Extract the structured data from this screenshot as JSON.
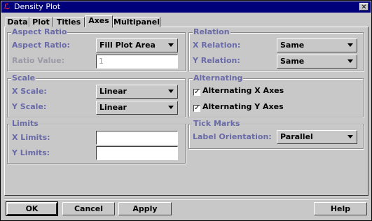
{
  "window": {
    "title": "Density Plot",
    "close_glyph": "✕",
    "app_icon": "ℒ"
  },
  "tabs": [
    {
      "label": "Data"
    },
    {
      "label": "Plot"
    },
    {
      "label": "Titles"
    },
    {
      "label": "Axes",
      "active": true
    },
    {
      "label": "Multipanel"
    }
  ],
  "aspect_ratio": {
    "title": "Aspect Ratio",
    "aspect_label": "Aspect Ratio:",
    "aspect_value": "Fill Plot Area",
    "ratio_label": "Ratio Value:",
    "ratio_value": "1"
  },
  "scale": {
    "title": "Scale",
    "x_label": "X Scale:",
    "x_value": "Linear",
    "y_label": "Y Scale:",
    "y_value": "Linear"
  },
  "limits": {
    "title": "Limits",
    "x_label": "X Limits:",
    "x_value": "",
    "y_label": "Y Limits:",
    "y_value": ""
  },
  "relation": {
    "title": "Relation",
    "x_label": "X Relation:",
    "x_value": "Same",
    "y_label": "Y Relation:",
    "y_value": "Same"
  },
  "alternating": {
    "title": "Alternating",
    "x_label": "Alternating X Axes",
    "x_checked": true,
    "y_label": "Alternating Y Axes",
    "y_checked": true,
    "check_glyph": "✓"
  },
  "tick_marks": {
    "title": "Tick Marks",
    "orientation_label": "Label Orientation:",
    "orientation_value": "Parallel"
  },
  "buttons": {
    "ok": "OK",
    "cancel": "Cancel",
    "apply": "Apply",
    "help": "Help"
  },
  "colors": {
    "titlebar": "#00007b",
    "background": "#c8c8c8",
    "label": "#6a6aa8"
  }
}
